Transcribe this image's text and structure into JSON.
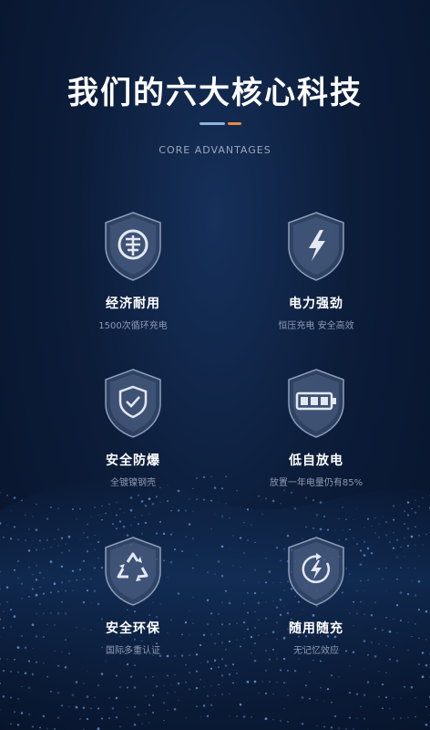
{
  "header": {
    "title": "我们的六大核心科技",
    "subtitle": "CORE ADVANTAGES",
    "accent_colors": [
      "#8fb2e0",
      "#e98a3c"
    ]
  },
  "features": [
    {
      "icon": "coin-icon",
      "title": "经济耐用",
      "desc": "1500次循环充电"
    },
    {
      "icon": "lightning-icon",
      "title": "电力强劲",
      "desc": "恒压充电 安全高效"
    },
    {
      "icon": "shield-check-icon",
      "title": "安全防爆",
      "desc": "全镀镍钢壳"
    },
    {
      "icon": "battery-icon",
      "title": "低自放电",
      "desc": "放置一年电量仍有85%"
    },
    {
      "icon": "recycle-icon",
      "title": "安全环保",
      "desc": "国际多重认证"
    },
    {
      "icon": "charge-cycle-icon",
      "title": "随用随充",
      "desc": "无记忆效应"
    }
  ]
}
